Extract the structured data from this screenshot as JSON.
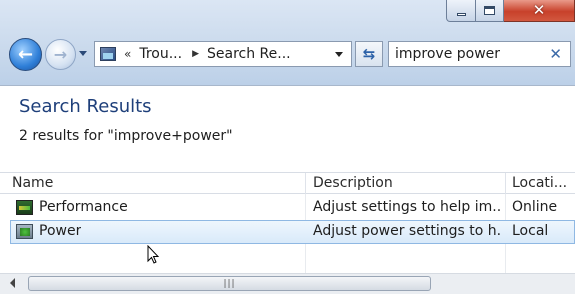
{
  "window": {
    "controls": {
      "close_glyph": "✕"
    }
  },
  "navigation": {
    "back_icon": "arrow-left",
    "forward_icon": "arrow-right",
    "address": {
      "sep": "«",
      "crumb1": "Trou...",
      "crumb2": "Search Re..."
    },
    "search": {
      "value": "improve power",
      "clear_glyph": "✕"
    }
  },
  "results": {
    "title": "Search Results",
    "summary": "2 results for \"improve+power\"",
    "columns": {
      "name": "Name",
      "description": "Description",
      "location": "Locati..."
    },
    "rows": [
      {
        "name": "Performance",
        "description": "Adjust settings to help im...",
        "location": "Online",
        "icon": "performance-icon"
      },
      {
        "name": "Power",
        "description": "Adjust power settings to h...",
        "location": "Local",
        "icon": "power-icon",
        "selected": true
      }
    ]
  },
  "scrollbar": {
    "grip": "|||"
  }
}
